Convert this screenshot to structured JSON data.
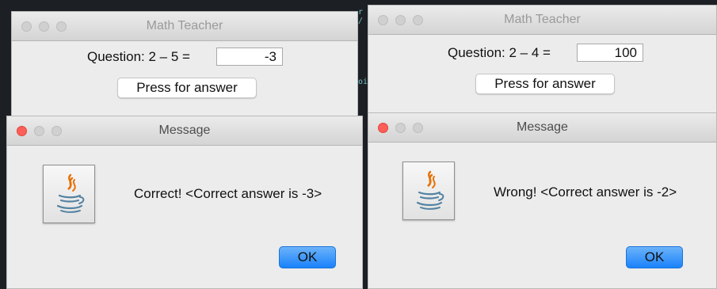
{
  "left": {
    "teacher_window": {
      "title": "Math Teacher",
      "question_label": "Question: 2 – 5 =",
      "answer_value": "-3",
      "button_label": "Press for answer"
    },
    "message_dialog": {
      "title": "Message",
      "text": "Correct! <Correct answer is -3>",
      "ok_label": "OK",
      "icon": "java-icon"
    }
  },
  "right": {
    "teacher_window": {
      "title": "Math Teacher",
      "question_label": "Question: 2 – 4 =",
      "answer_value": "100",
      "button_label": "Press for answer"
    },
    "message_dialog": {
      "title": "Message",
      "text": "Wrong! <Correct answer is -2>",
      "ok_label": "OK",
      "icon": "java-icon"
    }
  },
  "colors": {
    "ok_button": "#1a82fb",
    "close_button_active": "#fc5f57",
    "window_background": "#ececec",
    "desktop_background": "#1c2024"
  }
}
